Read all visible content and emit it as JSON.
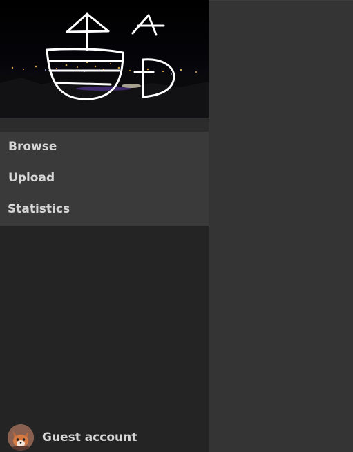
{
  "logo": {
    "letters": [
      "A",
      "D"
    ],
    "icon": "boat-drawing-logo"
  },
  "nav": {
    "items": [
      {
        "label": "Browse"
      },
      {
        "label": "Upload"
      },
      {
        "label": "Statistics"
      }
    ]
  },
  "account": {
    "name": "Guest account",
    "avatar_icon": "fox-avatar-icon"
  },
  "colors": {
    "sidebar_bg": "#242424",
    "nav_bg": "#3a3a3a",
    "main_bg": "#343434",
    "text": "#d6d6d6"
  }
}
